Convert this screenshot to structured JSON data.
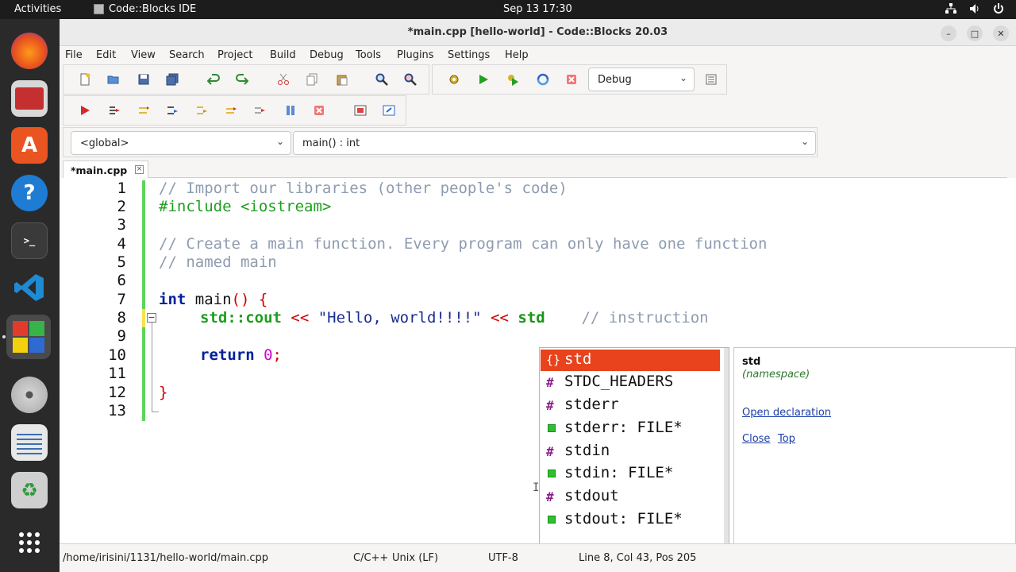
{
  "topbar": {
    "activities": "Activities",
    "app_name": "Code::Blocks IDE",
    "clock": "Sep 13  17:30",
    "tray_icons": [
      "network-icon",
      "volume-icon",
      "power-icon"
    ]
  },
  "dock": {
    "items": [
      "firefox-icon",
      "files-icon",
      "app-center-icon",
      "help-icon",
      "terminal-icon",
      "vscode-icon",
      "codeblocks-icon",
      "disc-icon",
      "text-editor-icon",
      "trash-icon",
      "app-grid-icon"
    ]
  },
  "window": {
    "title": "*main.cpp [hello-world] - Code::Blocks 20.03",
    "controls": {
      "minimize": "–",
      "maximize": "□",
      "close": "✕"
    }
  },
  "menu": [
    "File",
    "Edit",
    "View",
    "Search",
    "Project",
    "Build",
    "Debug",
    "Tools",
    "Plugins",
    "Settings",
    "Help"
  ],
  "toolbar": {
    "build_target": "Debug"
  },
  "scope": {
    "scope_value": "<global>",
    "function_value": "main() : int"
  },
  "tab": {
    "label": "*main.cpp",
    "close": "⊠"
  },
  "editor": {
    "line_numbers": [
      "1",
      "2",
      "3",
      "4",
      "5",
      "6",
      "7",
      "8",
      "9",
      "10",
      "11",
      "12",
      "13"
    ],
    "lines": {
      "l1": "// Import our libraries (other people's code)",
      "l2": "#include <iostream>",
      "l4": "// Create a main function. Every program can only have one function",
      "l5": "// named main",
      "l7_kw": "int",
      "l7_name": " main",
      "l7_paren": "()",
      "l7_brace": " {",
      "l8_ident": "std::cout",
      "l8_op1": " <<",
      "l8_str": " \"Hello, world!!!!\"",
      "l8_op2": " <<",
      "l8_std": " std",
      "l8_comment": "    // instruction",
      "l10_kw": "return",
      "l10_num": " 0",
      "l10_semi": ";",
      "l12_brace": "}"
    }
  },
  "autocomplete": {
    "items": [
      {
        "label": "std",
        "kind": "namespace"
      },
      {
        "label": "STDC_HEADERS",
        "kind": "macro"
      },
      {
        "label": "stderr",
        "kind": "macro"
      },
      {
        "label": "stderr: FILE*",
        "kind": "variable"
      },
      {
        "label": "stdin",
        "kind": "macro"
      },
      {
        "label": "stdin: FILE*",
        "kind": "variable"
      },
      {
        "label": "stdout",
        "kind": "macro"
      },
      {
        "label": "stdout: FILE*",
        "kind": "variable"
      }
    ],
    "selected_index": 0
  },
  "doc_popup": {
    "name": "std",
    "kind": "(namespace)",
    "open_declaration": "Open declaration",
    "close": "Close",
    "top": "Top"
  },
  "status": {
    "path": "/home/irisini/1131/hello-world/main.cpp",
    "language": "C/C++",
    "eol": "Unix (LF)",
    "encoding": "UTF-8",
    "position": "Line 8, Col 43, Pos 205"
  }
}
